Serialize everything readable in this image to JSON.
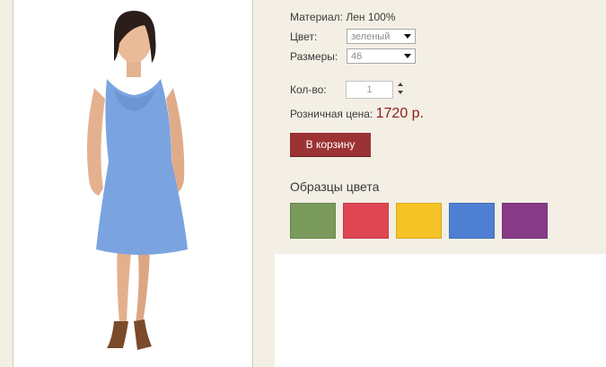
{
  "product": {
    "material_label": "Материал:",
    "material_value": "Лен 100%",
    "color_label": "Цвет:",
    "color_selected": "зеленый",
    "size_label": "Размеры:",
    "size_selected": "46",
    "qty_label": "Кол-во:",
    "qty_value": "1",
    "price_label": "Розничная цена:",
    "price_value": "1720 р.",
    "cart_button": "В корзину"
  },
  "swatches": {
    "title": "Образцы цвета",
    "colors": [
      "#7a9a5c",
      "#e04554",
      "#f5c326",
      "#4f7fd3",
      "#873a86"
    ]
  },
  "icons": [
    "chevron-down-icon",
    "stepper-up-icon",
    "stepper-down-icon"
  ]
}
